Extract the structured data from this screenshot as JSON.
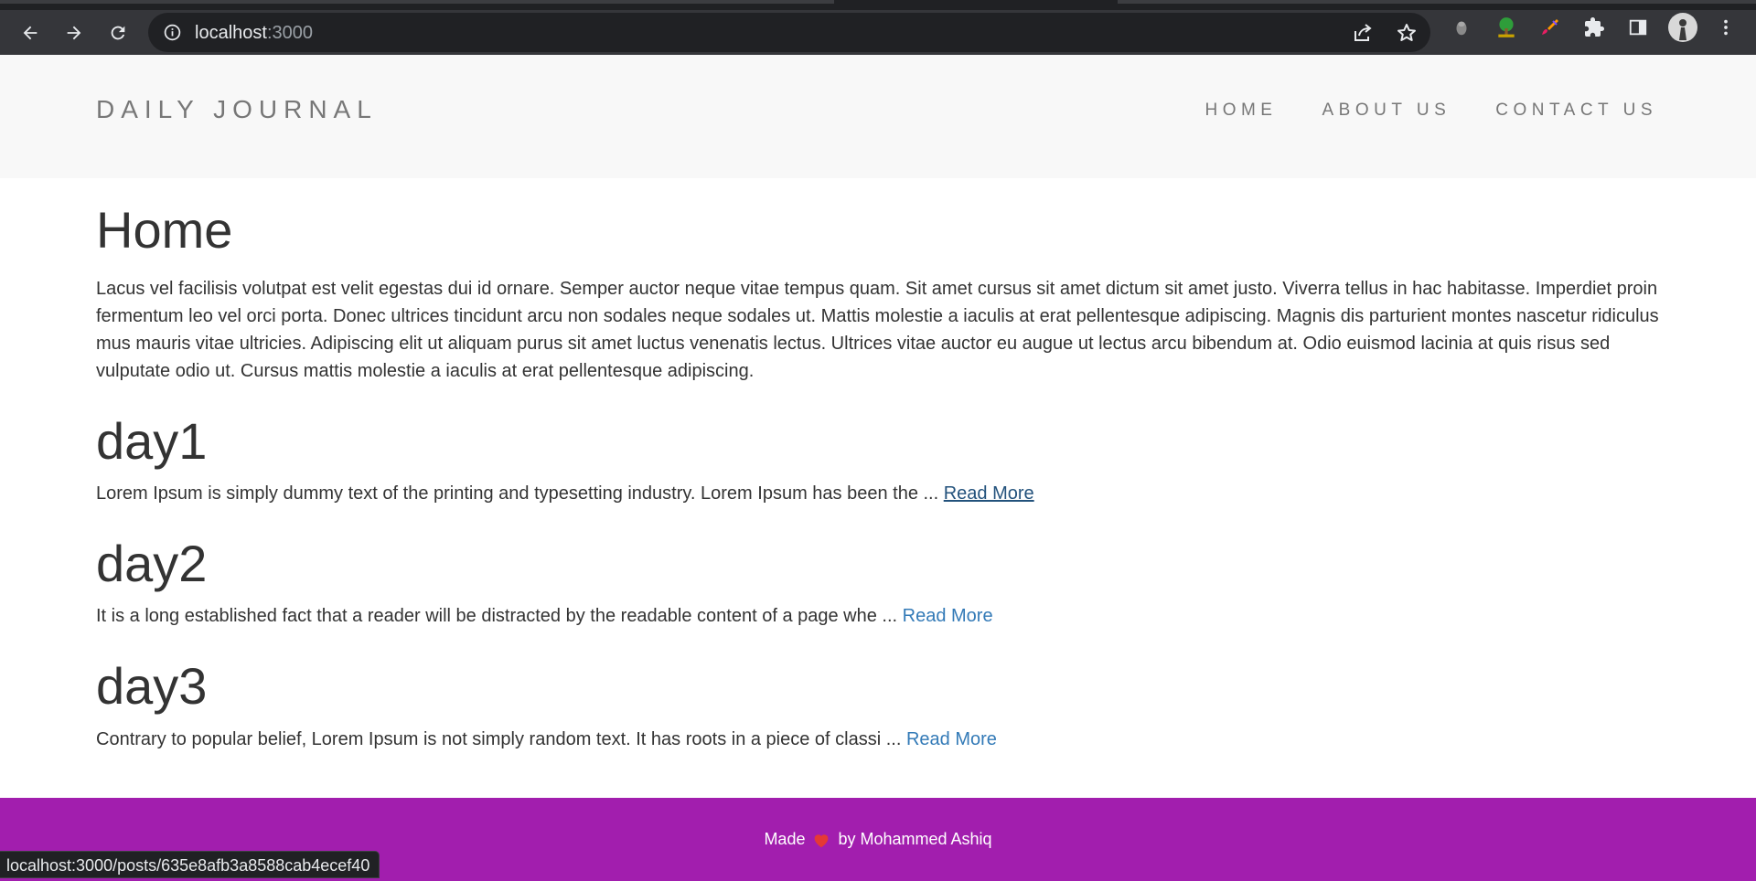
{
  "browser": {
    "url_host": "localhost",
    "url_port": ":3000",
    "status_url": "localhost:3000/posts/635e8afb3a8588cab4ecef40"
  },
  "site": {
    "brand": "DAILY JOURNAL",
    "nav": [
      "HOME",
      "ABOUT US",
      "CONTACT US"
    ]
  },
  "home": {
    "title": "Home",
    "intro": "Lacus vel facilisis volutpat est velit egestas dui id ornare. Semper auctor neque vitae tempus quam. Sit amet cursus sit amet dictum sit amet justo. Viverra tellus in hac habitasse. Imperdiet proin fermentum leo vel orci porta. Donec ultrices tincidunt arcu non sodales neque sodales ut. Mattis molestie a iaculis at erat pellentesque adipiscing. Magnis dis parturient montes nascetur ridiculus mus mauris vitae ultricies. Adipiscing elit ut aliquam purus sit amet luctus venenatis lectus. Ultrices vitae auctor eu augue ut lectus arcu bibendum at. Odio euismod lacinia at quis risus sed vulputate odio ut. Cursus mattis molestie a iaculis at erat pellentesque adipiscing."
  },
  "posts": [
    {
      "title": "day1",
      "excerpt": "Lorem Ipsum is simply dummy text of the printing and typesetting industry. Lorem Ipsum has been the ...",
      "read_more": "Read More"
    },
    {
      "title": "day2",
      "excerpt": "It is a long established fact that a reader will be distracted by the readable content of a page whe ...",
      "read_more": "Read More"
    },
    {
      "title": "day3",
      "excerpt": "Contrary to popular belief, Lorem Ipsum is not simply random text. It has roots in a piece of classi ...",
      "read_more": "Read More"
    }
  ],
  "footer": {
    "made": "Made",
    "by": "by Mohammed Ashiq"
  },
  "colors": {
    "header_bg": "#f8f8f8",
    "footer_bg": "#a21eae",
    "link": "#337ab7",
    "link_hover": "#23527c",
    "text": "#333333",
    "nav_text": "#777777"
  }
}
